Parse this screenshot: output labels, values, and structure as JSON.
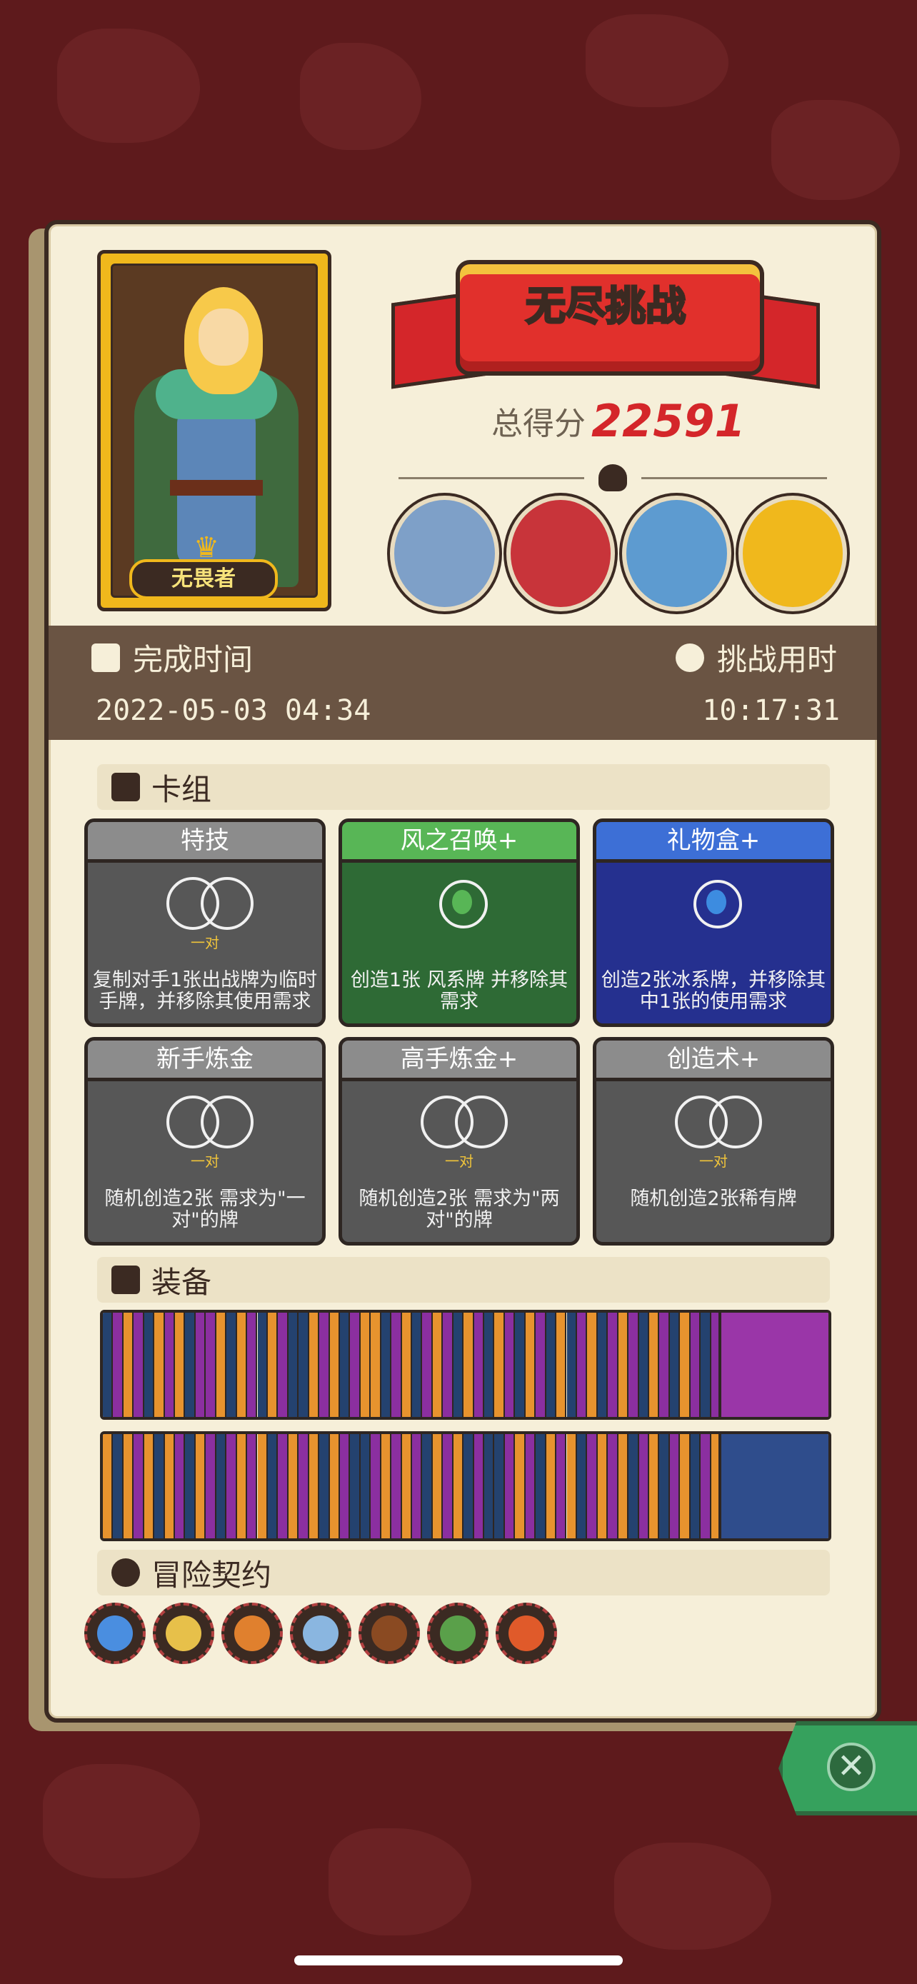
{
  "character": {
    "name": "无畏者"
  },
  "header": {
    "title": "无尽挑战",
    "score_label": "总得分",
    "score": "22591"
  },
  "enemies": [
    {
      "name": "enemy-frog-icon",
      "color": "#7ea0c8"
    },
    {
      "name": "enemy-cage-icon",
      "color": "#c8343a"
    },
    {
      "name": "enemy-knight-icon",
      "color": "#5d9bd0"
    },
    {
      "name": "enemy-pumpkin-icon",
      "color": "#f0b81c"
    }
  ],
  "timebar": {
    "complete_label": "完成时间",
    "complete_value": "2022-05-03 04:34",
    "duration_label": "挑战用时",
    "duration_value": "10:17:31"
  },
  "deck": {
    "title": "卡组",
    "cards": [
      {
        "title": "特技",
        "style": "gray",
        "badge": "一对",
        "desc": "复制对手1张出战牌为临时手牌，并移除其使用需求"
      },
      {
        "title": "风之召唤+",
        "style": "green",
        "badge": "",
        "desc": "创造1张 风系牌 并移除其需求"
      },
      {
        "title": "礼物盒+",
        "style": "blue",
        "badge": "",
        "desc": "创造2张冰系牌，并移除其中1张的使用需求"
      },
      {
        "title": "新手炼金",
        "style": "gray",
        "badge": "一对",
        "desc": "随机创造2张 需求为\"一对\"的牌"
      },
      {
        "title": "高手炼金+",
        "style": "gray",
        "badge": "一对",
        "desc": "随机创造2张 需求为\"两对\"的牌"
      },
      {
        "title": "创造术+",
        "style": "gray",
        "badge": "一对",
        "desc": "随机创造2张稀有牌"
      }
    ]
  },
  "equipment": {
    "title": "装备",
    "items": [
      {
        "name": "pendant-icon",
        "slot_color": "#9a36a8"
      },
      {
        "name": "spellbook-icon",
        "slot_color": "#2f4d8c"
      }
    ],
    "colors": {
      "purple": "#8b2fa0",
      "orange": "#e7932e",
      "navy": "#24426f"
    }
  },
  "contracts": {
    "title": "冒险契约",
    "items": [
      {
        "name": "blue-flame-skull-icon",
        "color": "#4a8ee0"
      },
      {
        "name": "flower-pot-icon",
        "color": "#e7c04a"
      },
      {
        "name": "roast-meat-icon",
        "color": "#e0802e"
      },
      {
        "name": "potion-bottle-icon",
        "color": "#8ab6e0"
      },
      {
        "name": "pipe-icon",
        "color": "#8a4a22"
      },
      {
        "name": "green-bird-icon",
        "color": "#5aa04a"
      },
      {
        "name": "explosion-icon",
        "color": "#e05a2a"
      }
    ]
  }
}
